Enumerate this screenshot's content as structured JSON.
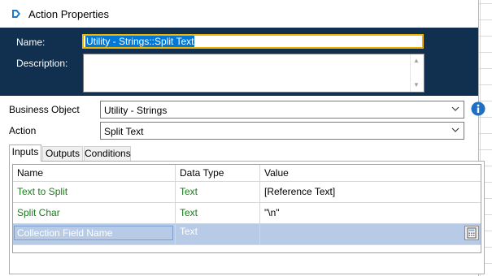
{
  "window": {
    "title": "Action Properties"
  },
  "header": {
    "name_label": "Name:",
    "name_value": "Utility - Strings::Split Text",
    "description_label": "Description:",
    "description_value": ""
  },
  "form": {
    "business_object_label": "Business Object",
    "business_object_value": "Utility - Strings",
    "action_label": "Action",
    "action_value": "Split Text"
  },
  "tabs": [
    {
      "label": "Inputs",
      "active": true
    },
    {
      "label": "Outputs",
      "active": false
    },
    {
      "label": "Conditions",
      "active": false
    }
  ],
  "inputs_grid": {
    "columns": [
      "Name",
      "Data Type",
      "Value"
    ],
    "rows": [
      {
        "name": "Text to Split",
        "data_type": "Text",
        "value": "[Reference Text]"
      },
      {
        "name": "Split Char",
        "data_type": "Text",
        "value": "\"\\n\""
      },
      {
        "name": "Collection Field Name",
        "data_type": "Text",
        "value": ""
      }
    ]
  },
  "icons": {
    "app": "app-icon",
    "info": "info-icon",
    "dropdown": "chevron-down-icon",
    "calculator": "calculator-icon",
    "scroll_up": "scroll-up-icon",
    "scroll_down": "scroll-down-icon"
  },
  "colors": {
    "header_bg": "#11304f",
    "focus_border": "#f0b400",
    "selection": "#0078d7",
    "row_selected": "#b7cae6",
    "input_text_green": "#1e7b1e",
    "info_blue": "#1f6fc5"
  }
}
